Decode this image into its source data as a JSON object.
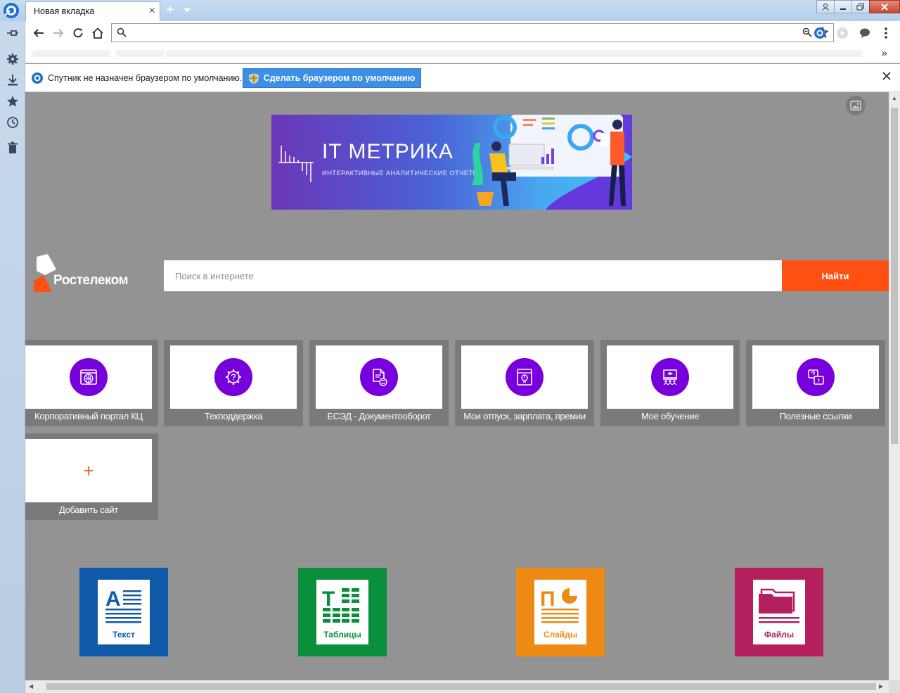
{
  "browser": {
    "tab_title": "Новая вкладка",
    "tab_close": "×",
    "new_tab": "+",
    "address": "",
    "bookmarks_more": "»"
  },
  "icons": {
    "app": "sputnik-logo-icon",
    "sidebar": [
      "pin-icon",
      "gear-icon",
      "download-icon",
      "star-icon",
      "history-icon",
      "trash-icon"
    ],
    "nav": [
      "back-icon",
      "forward-icon",
      "reload-icon",
      "home-icon"
    ],
    "extensions": [
      "sputnik-extension-icon",
      "lightning-extension-icon",
      "chat-extension-icon",
      "menu-dots-icon"
    ]
  },
  "infobar": {
    "message": "Спутник не назначен браузером по умолчанию.",
    "button": "Сделать браузером по умолчанию"
  },
  "banner": {
    "title": "IT МЕТРИКА",
    "subtitle": "ИНТЕРАКТИВНЫЕ АНАЛИТИЧЕСКИЕ ОТЧЕТЫ"
  },
  "search": {
    "logo_text": "Ростелеком",
    "placeholder": "Поиск в интернете",
    "button": "Найти"
  },
  "tiles": [
    {
      "label": "Корпоративный портал КЦ",
      "icon": "globe-icon"
    },
    {
      "label": "Техподдержка",
      "icon": "support-gear-icon"
    },
    {
      "label": "ЕСЭД - Документооборот",
      "icon": "document-sync-icon"
    },
    {
      "label": "Мои отпуск, зарплата, премии",
      "icon": "profile-window-icon"
    },
    {
      "label": "Мое обучение",
      "icon": "training-icon"
    },
    {
      "label": "Полезные ссылки",
      "icon": "help-chat-icon"
    }
  ],
  "add_tile": {
    "label": "Добавить сайт",
    "plus": "+"
  },
  "office": [
    {
      "label": "Текст",
      "glyph": "A",
      "color": "#0f5aa8"
    },
    {
      "label": "Таблицы",
      "glyph": "T",
      "color": "#0a8f3c"
    },
    {
      "label": "Слайды",
      "glyph": "П",
      "color": "#ec8a14"
    },
    {
      "label": "Файлы",
      "glyph": "",
      "color": "#b41f5e"
    }
  ],
  "colors": {
    "accent_purple": "#7700dd",
    "search_orange": "#ff4f12",
    "infobar_blue": "#3c8ee6",
    "page_bg": "#939393"
  }
}
